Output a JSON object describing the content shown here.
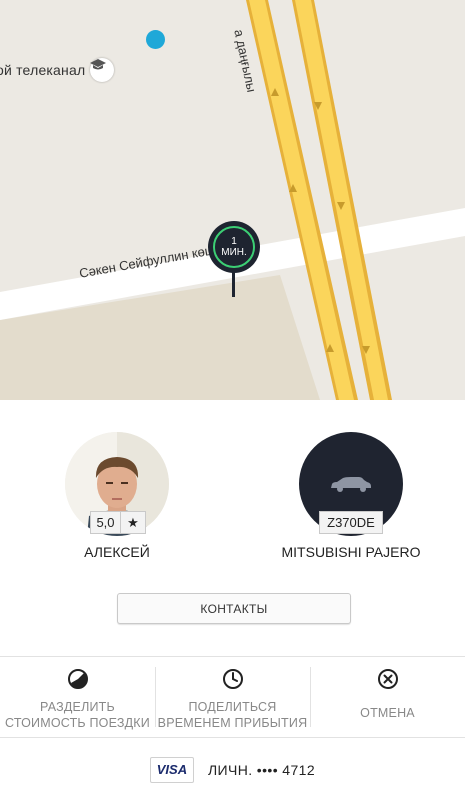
{
  "map": {
    "place_label": "ой телеканал",
    "street_horizontal": "Сәкен Сейфуллин көшесі",
    "street_vertical": "а даңғылы",
    "place_icon": "graduation-cap-icon",
    "eta": {
      "value": "1",
      "unit": "МИН."
    },
    "colors": {
      "ground": "#ece9e3",
      "road": "#fbd55b",
      "road_border": "#e6b13a",
      "pin": "#1e2430",
      "eta_ring": "#3ccf74",
      "location_dot": "#1fa8d8"
    }
  },
  "driver": {
    "name": "АЛЕКСЕЙ",
    "rating": "5,0",
    "rating_icon": "star-icon"
  },
  "car": {
    "model": "MITSUBISHI PAJERO",
    "plate": "Z370DE",
    "icon": "car-icon"
  },
  "contacts_button": "КОНТАКТЫ",
  "actions": [
    {
      "line1": "РАЗДЕЛИТЬ",
      "line2": "СТОИМОСТЬ ПОЕЗДКИ",
      "icon": "split-fare-icon"
    },
    {
      "line1": "ПОДЕЛИТЬСЯ",
      "line2": "ВРЕМЕНЕМ ПРИБЫТИЯ",
      "icon": "clock-icon"
    },
    {
      "line1": "ОТМЕНА",
      "icon": "cancel-icon"
    }
  ],
  "payment": {
    "card_brand": "VISA",
    "label": "ЛИЧН. •••• 4712"
  }
}
